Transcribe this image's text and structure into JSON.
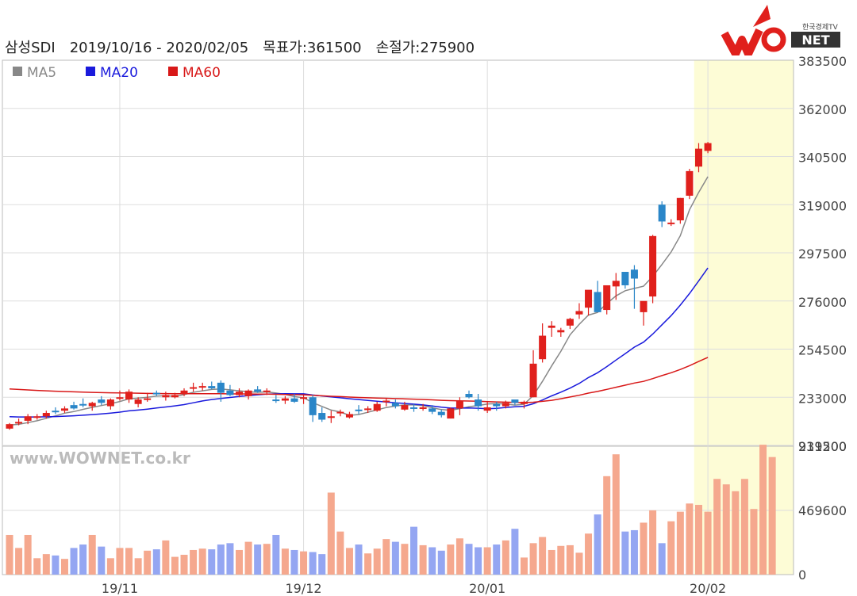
{
  "header": {
    "ticker": "삼성SDI",
    "period": "2019/10/16 - 2020/02/05",
    "target": "목표가:361500",
    "stop": "손절가:275900"
  },
  "logo": {
    "text": "WOWNET",
    "tag": "한국경제TV"
  },
  "watermark": "www.WOWNET.co.kr",
  "colors": {
    "up": "#e0201c",
    "down": "#2a86c8",
    "ma5": "#888888",
    "ma20": "#1a1adc",
    "ma60": "#d81818",
    "vol_up": "#f5a88e",
    "vol_down": "#94a6f2",
    "highlight": "#fdfcd6",
    "grid": "#dddddd"
  },
  "chart_data": {
    "type": "candlestick",
    "legend": [
      {
        "name": "MA5",
        "color": "#888888"
      },
      {
        "name": "MA20",
        "color": "#1a1adc"
      },
      {
        "name": "MA60",
        "color": "#d81818"
      }
    ],
    "price_ticks": [
      383500,
      362000,
      340500,
      319000,
      297500,
      276000,
      254500,
      233000,
      211500
    ],
    "volume_ticks": [
      939200,
      469600,
      0
    ],
    "x_labels": [
      {
        "label": "19/11",
        "index": 12
      },
      {
        "label": "19/12",
        "index": 32
      },
      {
        "label": "20/01",
        "index": 52
      },
      {
        "label": "20/02",
        "index": 76
      }
    ],
    "highlight_from_index": 75,
    "candles": [
      [
        219000,
        221500,
        218500,
        221000
      ],
      [
        221500,
        223500,
        220500,
        222000
      ],
      [
        222500,
        225500,
        221000,
        224500
      ],
      [
        224000,
        225500,
        223000,
        224500
      ],
      [
        224500,
        227000,
        223500,
        226000
      ],
      [
        227000,
        228500,
        225500,
        226500
      ],
      [
        227000,
        229000,
        226000,
        228000
      ],
      [
        229500,
        231000,
        227500,
        228000
      ],
      [
        230000,
        232500,
        228500,
        229500
      ],
      [
        229000,
        231000,
        227000,
        230500
      ],
      [
        232000,
        233500,
        229500,
        230500
      ],
      [
        229000,
        232500,
        227500,
        232000
      ],
      [
        233000,
        236000,
        231500,
        233000
      ],
      [
        232000,
        236500,
        230500,
        235500
      ],
      [
        230000,
        233000,
        228500,
        232000
      ],
      [
        232500,
        235000,
        231000,
        232500
      ],
      [
        235000,
        236000,
        233500,
        234500
      ],
      [
        233000,
        235500,
        231500,
        234000
      ],
      [
        233000,
        235000,
        232500,
        234000
      ],
      [
        234500,
        237000,
        233500,
        236000
      ],
      [
        237000,
        239500,
        235500,
        237500
      ],
      [
        237500,
        239500,
        236000,
        238000
      ],
      [
        238000,
        240000,
        236500,
        237000
      ],
      [
        239500,
        240500,
        231000,
        235000
      ],
      [
        236000,
        238500,
        233500,
        234000
      ],
      [
        234000,
        237000,
        233000,
        235500
      ],
      [
        233500,
        236500,
        232000,
        236000
      ],
      [
        236500,
        238000,
        235000,
        235500
      ],
      [
        235500,
        237000,
        234000,
        236000
      ],
      [
        232000,
        234000,
        230500,
        231500
      ],
      [
        231500,
        233500,
        230000,
        232500
      ],
      [
        232500,
        234500,
        230500,
        231000
      ],
      [
        232500,
        234000,
        230000,
        233000
      ],
      [
        233000,
        234000,
        222000,
        225000
      ],
      [
        226000,
        228500,
        222000,
        223000
      ],
      [
        224500,
        227000,
        221500,
        224500
      ],
      [
        226000,
        227500,
        224500,
        226500
      ],
      [
        224000,
        226500,
        223500,
        225500
      ],
      [
        227500,
        229500,
        225500,
        227000
      ],
      [
        227500,
        229000,
        226000,
        228000
      ],
      [
        227000,
        231000,
        226500,
        230000
      ],
      [
        231000,
        232500,
        229000,
        231500
      ],
      [
        230500,
        232000,
        228000,
        229000
      ],
      [
        227500,
        231000,
        227000,
        229500
      ],
      [
        228500,
        230000,
        226500,
        228000
      ],
      [
        228500,
        230000,
        227000,
        228500
      ],
      [
        228000,
        229500,
        225500,
        226500
      ],
      [
        226500,
        227500,
        224000,
        225000
      ],
      [
        223500,
        228500,
        223500,
        228000
      ],
      [
        228000,
        233000,
        225000,
        231500
      ],
      [
        234500,
        236000,
        232500,
        233000
      ],
      [
        232000,
        234500,
        227000,
        229000
      ],
      [
        227000,
        231000,
        226000,
        228500
      ],
      [
        230000,
        231000,
        227000,
        229000
      ],
      [
        229000,
        231500,
        228000,
        230500
      ],
      [
        232000,
        230500,
        229500,
        230500
      ],
      [
        230000,
        231500,
        228000,
        231000
      ],
      [
        233000,
        254000,
        233000,
        248000
      ],
      [
        250000,
        266000,
        248500,
        260500
      ],
      [
        264000,
        267000,
        260000,
        265000
      ],
      [
        262000,
        264000,
        260000,
        263000
      ],
      [
        265000,
        268500,
        263500,
        268000
      ],
      [
        270000,
        275000,
        268000,
        271500
      ],
      [
        273000,
        276000,
        269500,
        281000
      ],
      [
        280000,
        285000,
        272500,
        271000
      ],
      [
        272000,
        282000,
        270000,
        283000
      ],
      [
        282500,
        288500,
        276500,
        285000
      ],
      [
        289000,
        283500,
        281500,
        283000
      ],
      [
        290000,
        292000,
        272500,
        286000
      ],
      [
        271000,
        273000,
        265000,
        276000
      ],
      [
        278000,
        305500,
        275000,
        305000
      ],
      [
        319000,
        320500,
        309000,
        311500
      ],
      [
        311000,
        312500,
        309500,
        311000
      ],
      [
        312000,
        322000,
        310500,
        322000
      ],
      [
        323000,
        335000,
        321500,
        334000
      ],
      [
        336000,
        346500,
        333500,
        344000
      ],
      [
        343000,
        347000,
        342000,
        346500
      ]
    ],
    "volumes": [
      290000,
      195000,
      290000,
      120000,
      150000,
      140000,
      115000,
      195000,
      220000,
      290000,
      205000,
      120000,
      195000,
      195000,
      120000,
      175000,
      185000,
      250000,
      130000,
      145000,
      180000,
      190000,
      185000,
      220000,
      230000,
      180000,
      240000,
      220000,
      225000,
      290000,
      190000,
      180000,
      170000,
      165000,
      150000,
      600000,
      315000,
      195000,
      220000,
      155000,
      190000,
      260000,
      240000,
      225000,
      350000,
      215000,
      200000,
      175000,
      220000,
      265000,
      225000,
      200000,
      200000,
      220000,
      250000,
      335000,
      125000,
      230000,
      275000,
      180000,
      210000,
      215000,
      160000,
      300000,
      440000,
      720000,
      880000,
      315000,
      325000,
      380000,
      470000,
      230000,
      390000,
      460000,
      520000,
      510000,
      460000,
      700000,
      660000,
      610000,
      700000,
      480000,
      950000,
      860000
    ]
  }
}
